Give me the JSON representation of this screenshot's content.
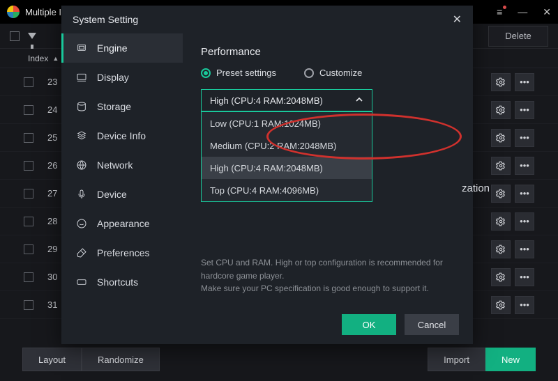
{
  "window": {
    "title": "Multiple Ins",
    "delete_label": "Delete",
    "index_header": "Index",
    "rows": [
      23,
      24,
      25,
      26,
      27,
      28,
      29,
      30,
      31
    ],
    "footer": {
      "layout": "Layout",
      "randomize": "Randomize",
      "import": "Import",
      "new": "New"
    }
  },
  "modal": {
    "title": "System Setting",
    "sidebar": [
      {
        "label": "Engine"
      },
      {
        "label": "Display"
      },
      {
        "label": "Storage"
      },
      {
        "label": "Device Info"
      },
      {
        "label": "Network"
      },
      {
        "label": "Device"
      },
      {
        "label": "Appearance"
      },
      {
        "label": "Preferences"
      },
      {
        "label": "Shortcuts"
      }
    ],
    "panel": {
      "heading": "Performance",
      "radio_preset": "Preset settings",
      "radio_custom": "Customize",
      "combo_value": "High (CPU:4 RAM:2048MB)",
      "options": [
        "Low (CPU:1 RAM:1024MB)",
        "Medium (CPU:2 RAM:2048MB)",
        "High (CPU:4 RAM:2048MB)",
        "Top (CPU:4 RAM:4096MB)"
      ],
      "bg_text_fragment": "zation",
      "hint_line1": "Set CPU and RAM. High or top configuration is recommended for hardcore game player.",
      "hint_line2": "Make sure your PC specification is good enough to support it."
    },
    "ok": "OK",
    "cancel": "Cancel"
  }
}
